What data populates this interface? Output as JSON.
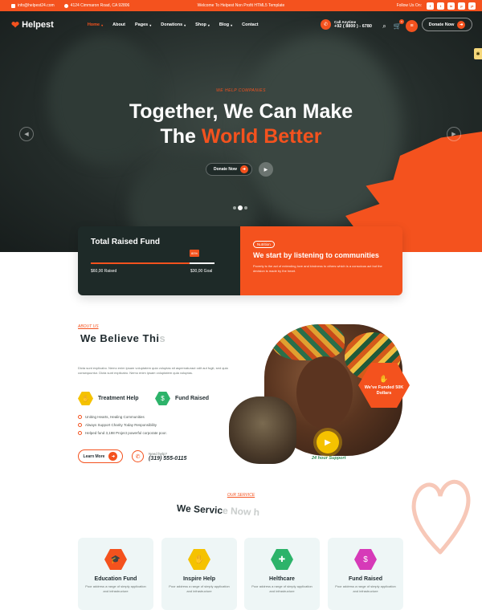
{
  "topbar": {
    "email": "info@helpest24.com",
    "address": "4124 Cimmaron Road, CA 92806",
    "welcome": "Welcome To Helpest Non Profit HTML5 Template",
    "follow_label": "Follow Us On:",
    "social": [
      "f",
      "t",
      "in",
      "p",
      "yt"
    ]
  },
  "nav": {
    "logo_text": "Helpest",
    "menu": [
      {
        "label": "Home",
        "caret": true,
        "active": true
      },
      {
        "label": "About",
        "caret": false,
        "active": false
      },
      {
        "label": "Pages",
        "caret": true,
        "active": false
      },
      {
        "label": "Donations",
        "caret": true,
        "active": false
      },
      {
        "label": "Shop",
        "caret": true,
        "active": false
      },
      {
        "label": "Blog",
        "caret": true,
        "active": false
      },
      {
        "label": "Contact",
        "caret": false,
        "active": false
      }
    ],
    "call_label": "Call Anytime",
    "call_number": "+92 ( 8800 ) - 6780",
    "cart_count": "0",
    "donate_label": "Donate Now"
  },
  "hero": {
    "eyebrow": "WE HELP COMPANIES",
    "title_line1": "Together, We Can Make",
    "title_line2_prefix": "The",
    "title_line2_highlight": "World Better",
    "donate_label": "Donate Now",
    "accent": "#f4521e"
  },
  "fund_card": {
    "title": "Total Raised Fund",
    "percent_label": "80%",
    "progress": 0.8,
    "raised": "$60,00 Raised",
    "goal": "$30,00 Goal",
    "tag": "Nutrition",
    "right_title": "We start by listening to communities",
    "right_desc": "Poverty is the act of extending love and kindness to others which is a conscious act but the decision is made by the heart."
  },
  "about": {
    "eyebrow": "ABOUT US",
    "heading_main": "We Believe Thi",
    "heading_fade": "s",
    "paragraph": "Dicta sunt explicabo. Nemo enim ipsam voluptatem quia voluptas sit aspernaturaut odit aut fugit, sed quia consequuntur. Dicta sunt explicabo. Nemo enim ipsam voluptatem quia voluptas.",
    "feature1": "Treatment Help",
    "feature2": "Fund Raised",
    "checks": [
      "Uniting Hearts, Healing Communities",
      "Always Support Charity Today Responsibility",
      "Helped fund 3,198 Project powerful corporate poor."
    ],
    "learn_label": "Learn More",
    "help_label": "Need help?",
    "help_number": "(319) 555-0115",
    "badge_text": "We've Funded 50K Dollars",
    "support_text": "24 hour Support"
  },
  "services": {
    "eyebrow": "OUR SERVICE",
    "heading_main": "We Servic",
    "heading_fade": "e Now h",
    "items": [
      {
        "title": "Education Fund",
        "desc": "Poor address a range of simply application and infrastructure",
        "color": "#f4521e",
        "icon": "graduation-cap-icon"
      },
      {
        "title": "Inspire Help",
        "desc": "Poor address a range of simply application and infrastructure",
        "color": "#f5c200",
        "icon": "hand-heart-icon"
      },
      {
        "title": "Helthcare",
        "desc": "Poor address a range of simply application and infrastructure",
        "color": "#2db36a",
        "icon": "medical-icon"
      },
      {
        "title": "Fund Raised",
        "desc": "Poor address a range of simply application and infrastructure",
        "color": "#d63ab8",
        "icon": "coin-icon"
      }
    ]
  }
}
